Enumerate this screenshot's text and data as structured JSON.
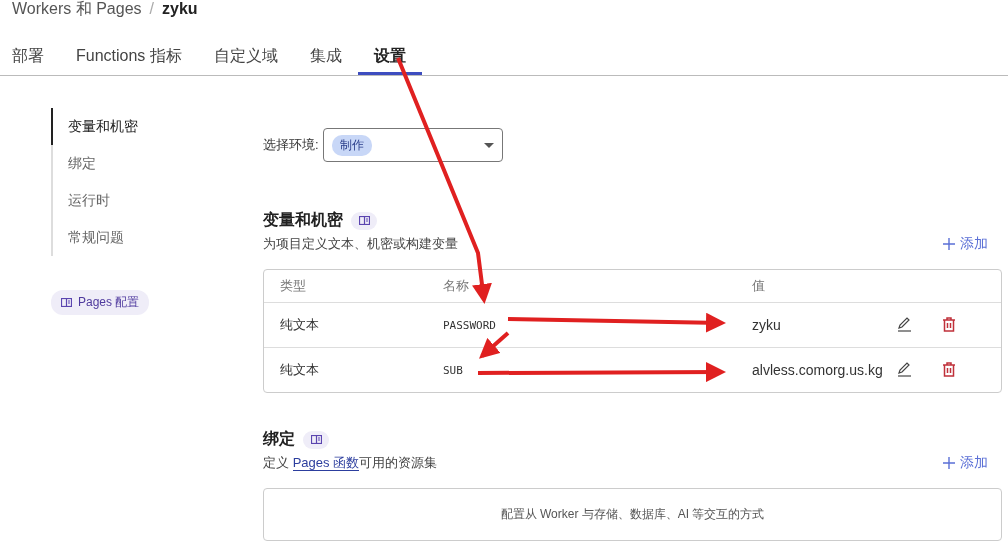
{
  "breadcrumb": {
    "parent": "Workers 和 Pages",
    "separator": "/",
    "current": "zyku"
  },
  "tabs": [
    {
      "label": "部署",
      "selected": false
    },
    {
      "label": "Functions 指标",
      "selected": false
    },
    {
      "label": "自定义域",
      "selected": false
    },
    {
      "label": "集成",
      "selected": false
    },
    {
      "label": "设置",
      "selected": true
    }
  ],
  "sidebar": {
    "items": [
      {
        "label": "变量和机密",
        "selected": true
      },
      {
        "label": "绑定",
        "selected": false
      },
      {
        "label": "运行时",
        "selected": false
      },
      {
        "label": "常规问题",
        "selected": false
      }
    ],
    "docs_button": "Pages 配置"
  },
  "environment": {
    "label": "选择环境:",
    "value": "制作"
  },
  "variables": {
    "title": "变量和机密",
    "description": "为项目定义文本、机密或构建变量",
    "add_button": "添加",
    "table": {
      "columns": [
        "类型",
        "名称",
        "值"
      ],
      "rows": [
        {
          "type": "纯文本",
          "name": "PASSWORD",
          "value": "zyku"
        },
        {
          "type": "纯文本",
          "name": "SUB",
          "value": "alvless.comorg.us.kg"
        }
      ]
    }
  },
  "bindings": {
    "title": "绑定",
    "description_before": "定义 ",
    "description_link": "Pages 函数",
    "description_after": "可用的资源集",
    "add_button": "添加",
    "empty_text": "配置从 Worker 与存储、数据库、AI 等交互的方式"
  }
}
